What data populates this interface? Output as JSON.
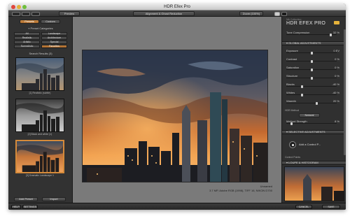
{
  "window": {
    "title": "HDR Efex Pro"
  },
  "toolbar": {
    "preview_label": "Preview",
    "compare_label": "Alignment & Ghost Reduction",
    "zoom_label": "Zoom (100%)"
  },
  "left_panel": {
    "tabs": [
      {
        "label": "Presets"
      },
      {
        "label": "Custom"
      }
    ],
    "categories_title": "Preset Categories",
    "categories": [
      {
        "label": "All"
      },
      {
        "label": "Landscape"
      },
      {
        "label": "Realistic"
      },
      {
        "label": "Architecture"
      },
      {
        "label": "Artistic"
      },
      {
        "label": "Special"
      },
      {
        "label": "Surrealistic"
      },
      {
        "label": "Favorites"
      }
    ],
    "results_title": "Search Results (3)",
    "thumbnails": [
      {
        "caption": "[1] Realistic (subtle)"
      },
      {
        "caption": "[2] Black and white (1)"
      },
      {
        "caption": "[3] Dramatic Landscape 1"
      }
    ],
    "add_preset_label": "Add Preset",
    "import_label": "Import"
  },
  "image_info": {
    "line1": "Unnamed",
    "line2": "3.7 MP, Adobe RGB (1998), TIFF 16, NIKON D700"
  },
  "right_panel": {
    "brand_small": "Nik Collection",
    "brand": "HDR EFEX PRO",
    "tone_compression": {
      "label": "Tone Compression",
      "value": "32 %"
    },
    "global_header": "GLOBAL ADJUSTMENTS",
    "sliders": [
      {
        "label": "Exposure",
        "value": "0 EV"
      },
      {
        "label": "Contrast",
        "value": "0 %"
      },
      {
        "label": "Saturation",
        "value": "0 %"
      },
      {
        "label": "Structure",
        "value": "0 %"
      },
      {
        "label": "Blacks",
        "value": "-40 %"
      },
      {
        "label": "Whites",
        "value": "-40 %"
      },
      {
        "label": "Warmth",
        "value": "20 %"
      }
    ],
    "hdr_method_label": "HDR Method",
    "hdr_method_value": "Natural",
    "method_strength": {
      "label": "Method Strength",
      "value": "8 %"
    },
    "selective_header": "SELECTIVE ADJUSTMENTS",
    "add_control_point": "Add a Control P...",
    "control_points_label": "Control Points",
    "loupe_header": "LOUPE & HISTOGRAM"
  },
  "bottom_bar": {
    "help": "HELP",
    "settings": "SETTINGS",
    "cancel": "CANCEL",
    "save": "SAVE"
  },
  "colors": {
    "accent_orange": "#d58a3a",
    "panel_bg": "#303030",
    "canvas_bg": "#7a7a7a"
  }
}
